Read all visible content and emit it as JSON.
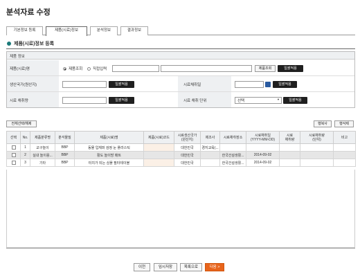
{
  "page": {
    "title": "분석자료 수정"
  },
  "tabs": [
    {
      "label": "기본정보 등록"
    },
    {
      "label": "제품(시료)정보"
    },
    {
      "label": "분석정보"
    },
    {
      "label": "결과정보"
    }
  ],
  "section": {
    "title": "제품(시료)정보 등록"
  },
  "product_panel": {
    "header": "제품 정보",
    "name_label": "제품(시료)명",
    "radio_search": "제품조회",
    "radio_direct": "직접입력",
    "search_button": "제품조회",
    "batch_button": "일괄적용",
    "origin_label": "생산국가(원산지)",
    "sample_date_label": "시료채취일",
    "sample_qty_label": "시료 채취량",
    "sample_unit_label": "시료 채취 단위",
    "unit_select_value": "선택"
  },
  "grid_actions": {
    "select_all": "전체선택/해제",
    "copy_row": "행복사",
    "delete_row": "행삭제"
  },
  "table": {
    "headers": [
      "선택",
      "No.",
      "제품분류명",
      "분석물질",
      "제품(시료)명",
      "제품(시료)코드",
      "시료생산국가\n(원산지)",
      "제조사",
      "시료채취장소",
      "시료채취일\n(YYYY-MM-DD)",
      "시료\n채취량",
      "시료채취량\n(단위)",
      "비고"
    ],
    "rows": [
      {
        "no": "1",
        "category": "교구놀이",
        "substance": "BBP",
        "name": "동물 입체퍼 검정 눈 플라스틱",
        "code": "",
        "origin": "대한민국",
        "maker": "경지교육(...",
        "place": "",
        "date": "",
        "qty": "",
        "unit": "",
        "note": ""
      },
      {
        "no": "2",
        "category": "실내 놀이용...",
        "substance": "BBP",
        "name": "활도 놀이방 매트",
        "code": "",
        "origin": "대한민국",
        "maker": "",
        "place": "한국건설생활...",
        "date": "2014-09-02",
        "qty": "",
        "unit": "",
        "note": ""
      },
      {
        "no": "3",
        "category": "기타",
        "substance": "BBP",
        "name": "터치가 되는 심플 필터테이블",
        "code": "",
        "origin": "대한민국",
        "maker": "",
        "place": "한국건설생활...",
        "date": "2014-09-02",
        "qty": "",
        "unit": "",
        "note": ""
      }
    ]
  },
  "footer": {
    "prev": "이전",
    "temp_save": "임시저장",
    "list": "목록으로",
    "next": "다음 >"
  },
  "colors": {
    "accent": "#1b7a7a",
    "next_button": "#e8641b",
    "dark_button": "#1f1f1f"
  }
}
